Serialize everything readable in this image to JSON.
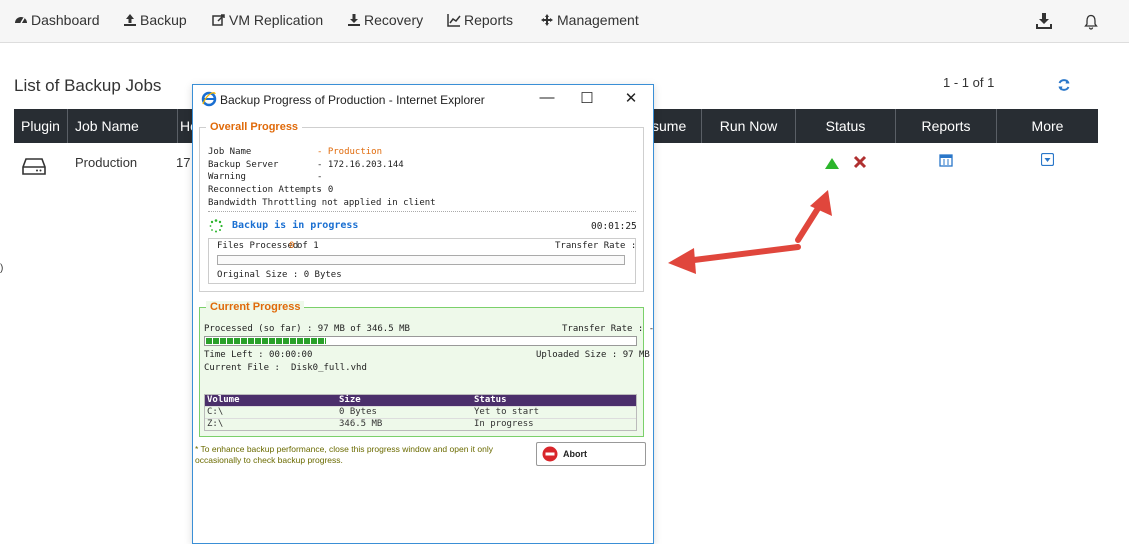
{
  "nav": {
    "items": [
      {
        "label": "Dashboard",
        "icon": "dashboard-icon"
      },
      {
        "label": "Backup",
        "icon": "upload-icon"
      },
      {
        "label": "VM Replication",
        "icon": "replication-icon"
      },
      {
        "label": "Recovery",
        "icon": "download-icon"
      },
      {
        "label": "Reports",
        "icon": "chart-icon"
      },
      {
        "label": "Management",
        "icon": "move-icon"
      }
    ]
  },
  "page": {
    "title": "List of Backup Jobs",
    "pager": "1 - 1 of 1"
  },
  "table": {
    "headers": [
      "Plugin",
      "Job Name",
      "Ho",
      "sume",
      "Run Now",
      "Status",
      "Reports",
      "More"
    ],
    "row": {
      "job_name": "Production",
      "host_prefix": "17"
    }
  },
  "popup": {
    "window_title": "Backup Progress of Production - Internet Explorer",
    "overall": {
      "legend": "Overall Progress",
      "fields": [
        {
          "label": "Job Name",
          "value": "- Production"
        },
        {
          "label": "Backup Server",
          "value": "- 172.16.203.144"
        },
        {
          "label": "Warning",
          "value": "-"
        },
        {
          "label": "Reconnection Attempts",
          "value": "- 0"
        }
      ],
      "throttle_note": "Bandwidth Throttling not applied in client",
      "status_text": "Backup is in progress",
      "elapsed": "00:01:25",
      "files_processed_label": "Files Processed",
      "files_processed_num": "0",
      "files_processed_of": "of 1",
      "transfer_rate_label": "Transfer Rate :",
      "original_size": "Original Size : 0 Bytes"
    },
    "current": {
      "legend": "Current Progress",
      "processed": "Processed (so far) : 97 MB  of  346.5 MB",
      "transfer_rate": "Transfer Rate : -",
      "progress_fraction": 0.28,
      "time_left": "Time Left : 00:00:00",
      "uploaded": "Uploaded Size : 97 MB",
      "current_file_label": "Current File :",
      "current_file": "Disk0_full.vhd",
      "volume_headers": [
        "Volume",
        "Size",
        "Status"
      ],
      "volumes": [
        [
          "C:\\",
          "0 Bytes",
          "Yet to start"
        ],
        [
          "Z:\\",
          "346.5 MB",
          "In progress"
        ]
      ]
    },
    "note": "* To enhance backup performance, close this progress window and open it only occasionally to check backup progress.",
    "abort_label": "Abort"
  },
  "colors": {
    "accent_orange": "#e06a0a",
    "header_dark": "#282d33",
    "status_green": "#2cb52c",
    "status_red": "#b03030",
    "arrow_red": "#e0463c",
    "link_blue": "#1a6fd1"
  }
}
